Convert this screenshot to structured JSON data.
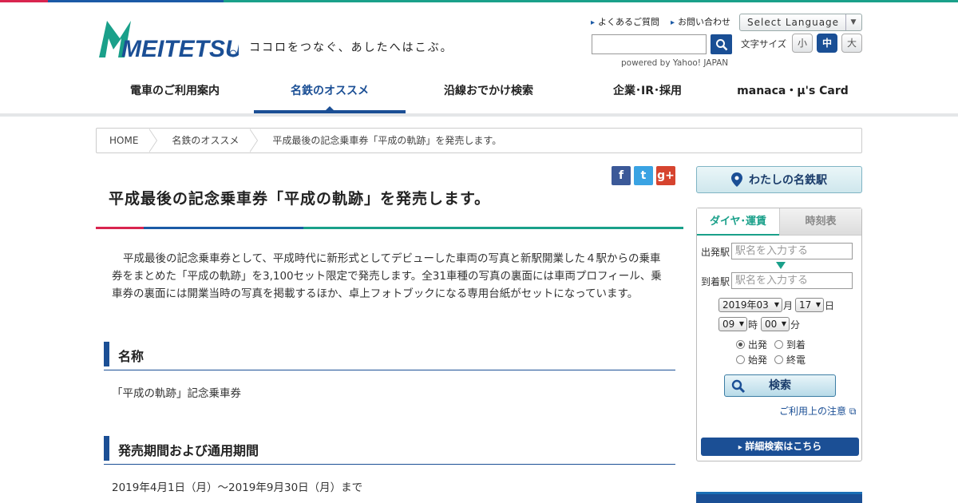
{
  "header": {
    "logo_text": "MEITETSU",
    "tagline": "ココロをつなぐ、あしたへはこぶ。",
    "utility_links": [
      "よくあるご質問",
      "お問い合わせ"
    ],
    "language_select": "Select Language",
    "powered_by": "powered by Yahoo! JAPAN",
    "font_size_label": "文字サイズ",
    "font_sizes": [
      "小",
      "中",
      "大"
    ],
    "font_size_selected": "中"
  },
  "nav": {
    "items": [
      "電車のご利用案内",
      "名鉄のオススメ",
      "沿線おでかけ検索",
      "企業･IR･採用",
      "manaca・μ's Card"
    ],
    "active": "名鉄のオススメ"
  },
  "breadcrumb": [
    "HOME",
    "名鉄のオススメ",
    "平成最後の記念乗車券「平成の軌跡」を発売します。"
  ],
  "article": {
    "title": "平成最後の記念乗車券「平成の軌跡」を発売します。",
    "lead": "平成最後の記念乗車券として、平成時代に新形式としてデビューした車両の写真と新駅開業した４駅からの乗車券をまとめた「平成の軌跡」を3,100セット限定で発売します。全31車種の写真の裏面には車両プロフィール、乗車券の裏面には開業当時の写真を掲載するほか、卓上フォトブックになる専用台紙がセットになっています。",
    "sections": [
      {
        "heading": "名称",
        "body": "「平成の軌跡」記念乗車券"
      },
      {
        "heading": "発売期間および通用期間",
        "body": "2019年4月1日（月）～2019年9月30日（月）まで"
      }
    ]
  },
  "social": [
    "f",
    "t",
    "g+"
  ],
  "sidebar": {
    "my_station": "わたしの名鉄駅",
    "tabs": [
      "ダイヤ･運賃",
      "時刻表"
    ],
    "from_label": "出発駅",
    "to_label": "到着駅",
    "station_placeholder": "駅名を入力する",
    "year_month": "2019年03",
    "month_unit": "月",
    "day": "17",
    "day_unit": "日",
    "hour": "09",
    "hour_unit": "時",
    "minute": "00",
    "minute_unit": "分",
    "radios": [
      "出発",
      "到着",
      "始発",
      "終電"
    ],
    "radio_selected": "出発",
    "search_button": "検索",
    "notice_link": "ご利用上の注意",
    "detail_button": "詳細検索はこちら"
  },
  "colors": {
    "brand_blue": "#1b4f95",
    "accent_red": "#d9254f",
    "accent_green": "#1aa08a"
  }
}
